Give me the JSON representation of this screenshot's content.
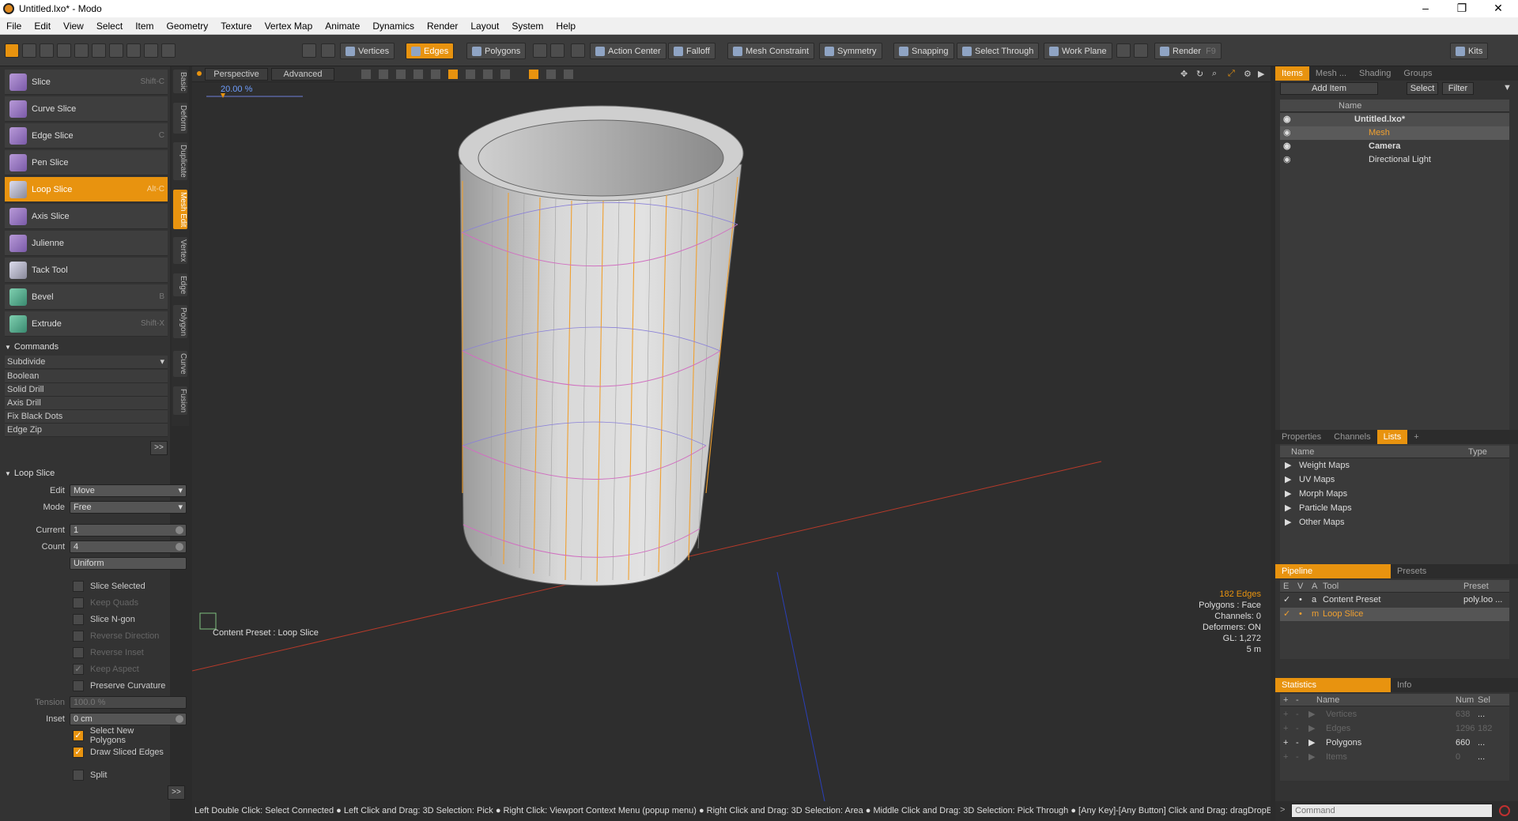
{
  "window": {
    "title": "Untitled.lxo* - Modo",
    "minimize": "–",
    "restore": "❐",
    "close": "✕"
  },
  "menu": [
    "File",
    "Edit",
    "View",
    "Select",
    "Item",
    "Geometry",
    "Texture",
    "Vertex Map",
    "Animate",
    "Dynamics",
    "Render",
    "Layout",
    "System",
    "Help"
  ],
  "toolbar": {
    "vertices": "Vertices",
    "edges": "Edges",
    "polygons": "Polygons",
    "action_center": "Action Center",
    "falloff": "Falloff",
    "mesh_constraint": "Mesh Constraint",
    "symmetry": "Symmetry",
    "snapping": "Snapping",
    "select_through": "Select Through",
    "work_plane": "Work Plane",
    "render": "Render",
    "render_key": "F9",
    "kits": "Kits"
  },
  "tools": [
    {
      "label": "Slice",
      "shortcut": "Shift-C"
    },
    {
      "label": "Curve Slice",
      "shortcut": ""
    },
    {
      "label": "Edge Slice",
      "shortcut": "C"
    },
    {
      "label": "Pen Slice",
      "shortcut": ""
    },
    {
      "label": "Loop Slice",
      "shortcut": "Alt-C"
    },
    {
      "label": "Axis Slice",
      "shortcut": ""
    },
    {
      "label": "Julienne",
      "shortcut": ""
    },
    {
      "label": "Tack Tool",
      "shortcut": ""
    },
    {
      "label": "Bevel",
      "shortcut": "B"
    },
    {
      "label": "Extrude",
      "shortcut": "Shift-X"
    }
  ],
  "side_tabs": [
    "Basic",
    "Deform",
    "Duplicate",
    "Mesh Edit",
    "Vertex",
    "Edge",
    "Polygon",
    "Curve",
    "Fusion"
  ],
  "commands": {
    "header": "Commands",
    "subdivide": "Subdivide",
    "items": [
      "Boolean",
      "Solid Drill",
      "Axis Drill",
      "Fix Black Dots",
      "Edge Zip"
    ],
    "more": ">>"
  },
  "loop_slice": {
    "header": "Loop Slice",
    "edit_label": "Edit",
    "edit_value": "Move",
    "mode_label": "Mode",
    "mode_value": "Free",
    "current_label": "Current",
    "current_value": "1",
    "count_label": "Count",
    "count_value": "4",
    "uniform": "Uniform",
    "checks": [
      {
        "label": "Slice Selected",
        "on": false,
        "dim": false
      },
      {
        "label": "Keep Quads",
        "on": false,
        "dim": true
      },
      {
        "label": "Slice N-gon",
        "on": false,
        "dim": false
      },
      {
        "label": "Reverse Direction",
        "on": false,
        "dim": true
      },
      {
        "label": "Reverse Inset",
        "on": false,
        "dim": true
      },
      {
        "label": "Keep Aspect",
        "on": true,
        "dim": true
      },
      {
        "label": "Preserve Curvature",
        "on": false,
        "dim": false
      }
    ],
    "tension_label": "Tension",
    "tension_value": "100.0 %",
    "inset_label": "Inset",
    "inset_value": "0 cm",
    "checks2": [
      {
        "label": "Select New Polygons",
        "on": true
      },
      {
        "label": "Draw Sliced Edges",
        "on": true
      }
    ],
    "split": "Split",
    "more": ">>"
  },
  "viewport": {
    "view": "Perspective",
    "advanced": "Advanced",
    "slider_pct": "20.00 %",
    "preset_label": "Content Preset : Loop Slice",
    "info": [
      "182 Edges",
      "Polygons : Face",
      "Channels: 0",
      "Deformers: ON",
      "GL: 1,272",
      "5 m"
    ]
  },
  "items_panel": {
    "tabs": [
      "Items",
      "Mesh ...",
      "Shading",
      "Groups"
    ],
    "add_item": "Add Item",
    "select": "Select",
    "filter": "Filter",
    "col_name": "Name",
    "tree": [
      {
        "label": "Untitled.lxo*",
        "indent": 0
      },
      {
        "label": "Mesh",
        "indent": 1
      },
      {
        "label": "Camera",
        "indent": 1
      },
      {
        "label": "Directional Light",
        "indent": 1
      }
    ]
  },
  "lists_panel": {
    "tabs": [
      "Properties",
      "Channels",
      "Lists",
      "+"
    ],
    "col_name": "Name",
    "col_type": "Type",
    "rows": [
      "Weight Maps",
      "UV Maps",
      "Morph Maps",
      "Particle Maps",
      "Other Maps"
    ]
  },
  "pipeline": {
    "tabs": [
      "Pipeline",
      "Presets"
    ],
    "cols": [
      "E",
      "V",
      "A",
      "Tool",
      "Preset"
    ],
    "rows": [
      {
        "a": "a",
        "tool": "Content Preset",
        "preset": "poly.loo ..."
      },
      {
        "a": "m",
        "tool": "Loop Slice",
        "preset": ""
      }
    ]
  },
  "statistics": {
    "tabs": [
      "Statistics",
      "Info"
    ],
    "cols": [
      "Name",
      "Num",
      "Sel"
    ],
    "rows": [
      {
        "name": "Vertices",
        "num": "638",
        "sel": "...",
        "dim": true
      },
      {
        "name": "Edges",
        "num": "1296",
        "sel": "182",
        "dim": true
      },
      {
        "name": "Polygons",
        "num": "660",
        "sel": "...",
        "dim": false
      },
      {
        "name": "Items",
        "num": "0",
        "sel": "...",
        "dim": true
      }
    ]
  },
  "status": "Left Double Click: Select Connected ● Left Click and Drag: 3D Selection: Pick ● Right Click: Viewport Context Menu (popup menu) ● Right Click and Drag: 3D Selection: Area ● Middle Click and Drag: 3D Selection: Pick Through ● [Any Key]-[Any Button] Click and Drag: dragDropB ...",
  "command_placeholder": "Command"
}
